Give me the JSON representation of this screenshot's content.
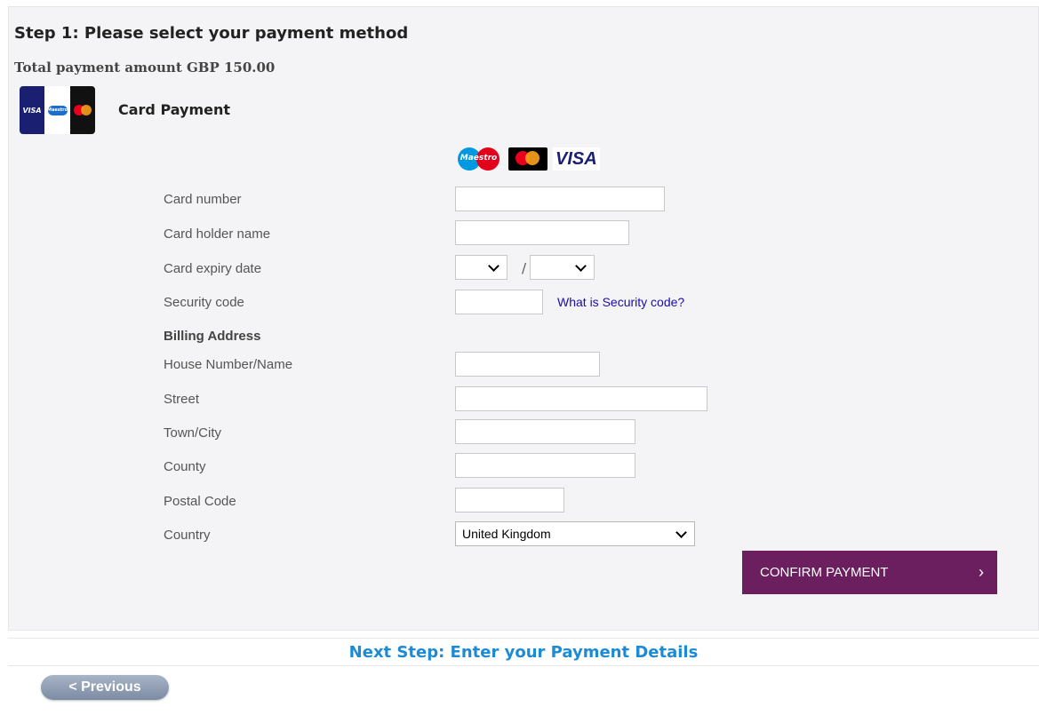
{
  "step": {
    "title": "Step 1: Please select your payment method",
    "total": "Total payment amount GBP 150.00"
  },
  "payment_method": {
    "label": "Card Payment",
    "logo_marks": [
      "VISA",
      "Maestro"
    ]
  },
  "brands": {
    "maestro": "Maestro",
    "visa": "VISA"
  },
  "form": {
    "card_number_label": "Card number",
    "card_holder_label": "Card holder name",
    "expiry_label": "Card expiry date",
    "expiry_separator": "/",
    "security_label": "Security code",
    "security_help": "What is Security code?",
    "billing_heading": "Billing Address",
    "house_label": "House Number/Name",
    "street_label": "Street",
    "town_label": "Town/City",
    "county_label": "County",
    "postal_label": "Postal Code",
    "country_label": "Country",
    "country_value": "United Kingdom"
  },
  "actions": {
    "confirm": "CONFIRM PAYMENT",
    "confirm_arrow": "›",
    "next_step": "Next Step: Enter your Payment Details",
    "previous": "< Previous"
  },
  "colors": {
    "confirm_bg": "#6b1f5f",
    "next_step_text": "#1d8bd4",
    "link": "#1a0dab"
  }
}
